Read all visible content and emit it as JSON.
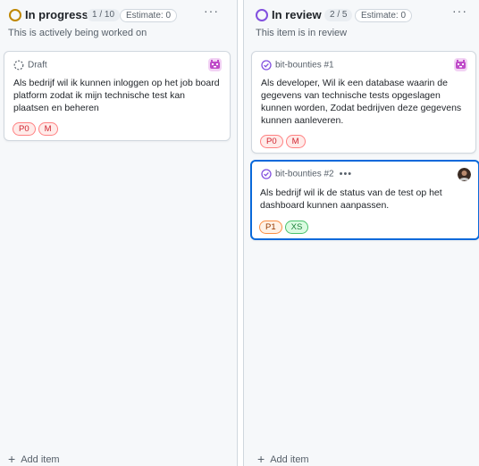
{
  "colors": {
    "in_progress_status": "#bf8700",
    "in_review_status": "#8250df",
    "selected_border": "#0969da",
    "label_red": "#cf222e",
    "label_orange": "#953800",
    "label_green": "#1a7f37"
  },
  "columns": [
    {
      "title": "In progress",
      "count": "1 / 10",
      "estimate": "Estimate: 0",
      "description": "This is actively being worked on",
      "add_item": "Add item",
      "cards": [
        {
          "type": "Draft",
          "icon": "draft-circle-icon",
          "text": "Als bedrijf wil ik kunnen inloggen op het job board platform zodat ik mijn technische test kan plaatsen en beheren",
          "labels": [
            "P0",
            "M"
          ],
          "avatar": "bot-avatar"
        }
      ]
    },
    {
      "title": "In review",
      "count": "2 / 5",
      "estimate": "Estimate: 0",
      "description": "This item is in review",
      "add_item": "Add item",
      "cards": [
        {
          "type": "bit-bounties #1",
          "icon": "issue-closed-icon",
          "text": "Als developer, Wil ik een database waarin de gegevens van technische tests opgeslagen kunnen worden, Zodat bedrijven deze gegevens kunnen aanleveren.",
          "labels": [
            "P0",
            "M"
          ],
          "avatar": "bot-avatar"
        },
        {
          "type": "bit-bounties #2",
          "icon": "issue-closed-icon",
          "text": "Als bedrijf wil ik de status van de test op het dashboard kunnen aanpassen.",
          "labels": [
            "P1",
            "XS"
          ],
          "avatar": "user-avatar",
          "more": "•••"
        }
      ]
    }
  ],
  "more_icon": "···"
}
